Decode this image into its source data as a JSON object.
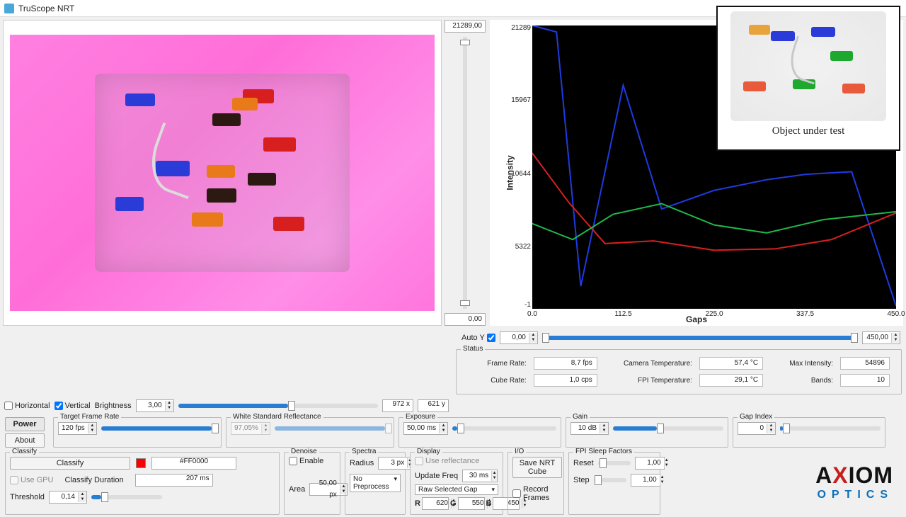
{
  "window": {
    "title": "TruScope NRT"
  },
  "vslider": {
    "top_value": "21289,00",
    "bottom_value": "0,00"
  },
  "chart_data": {
    "type": "line",
    "xlabel": "Gaps",
    "ylabel": "Intensity",
    "xlim": [
      0,
      450
    ],
    "ylim": [
      -1,
      21289
    ],
    "yticks": [
      "21289",
      "15967",
      "10644",
      "5322",
      "-1"
    ],
    "xticks": [
      "0.0",
      "112.5",
      "225.0",
      "337.5",
      "450.0"
    ],
    "series": [
      {
        "name": "blue",
        "color": "#1f3be0",
        "x": [
          0,
          30,
          60,
          112.5,
          160,
          225,
          290,
          337.5,
          395,
          450
        ],
        "y": [
          21289,
          20800,
          1700,
          16800,
          7500,
          8900,
          9700,
          10100,
          10300,
          200
        ]
      },
      {
        "name": "red",
        "color": "#d81f1f",
        "x": [
          0,
          45,
          90,
          150,
          225,
          300,
          370,
          450
        ],
        "y": [
          11700,
          8000,
          4900,
          5100,
          4400,
          4500,
          5200,
          7200
        ]
      },
      {
        "name": "green",
        "color": "#1fb84a",
        "x": [
          0,
          50,
          100,
          160,
          225,
          290,
          360,
          450
        ],
        "y": [
          6400,
          5200,
          7100,
          7900,
          6300,
          5700,
          6700,
          7300
        ]
      }
    ]
  },
  "auto_y": {
    "label": "Auto Y",
    "checked": true,
    "min": "0,00",
    "max": "450,00"
  },
  "status": {
    "legend": "Status",
    "frame_rate_label": "Frame Rate:",
    "frame_rate": "8,7 fps",
    "cube_rate_label": "Cube Rate:",
    "cube_rate": "1,0 cps",
    "cam_temp_label": "Camera Temperature:",
    "cam_temp": "57,4 °C",
    "fpi_temp_label": "FPI Temperature:",
    "fpi_temp": "29,1 °C",
    "max_int_label": "Max Intensity:",
    "max_int": "54896",
    "bands_label": "Bands:",
    "bands": "10"
  },
  "imgctrl": {
    "horizontal_label": "Horizontal",
    "horizontal_checked": false,
    "vertical_label": "Vertical",
    "vertical_checked": true,
    "brightness_label": "Brightness",
    "brightness_value": "3,00",
    "coord_x": "972 x",
    "coord_y": "621 y"
  },
  "tabs": {
    "power": "Power",
    "about": "About"
  },
  "target_fr": {
    "legend": "Target Frame Rate",
    "value": "120 fps"
  },
  "white_std": {
    "legend": "White Standard Reflectance",
    "value": "97,05%"
  },
  "exposure": {
    "legend": "Exposure",
    "value": "50,00 ms"
  },
  "gain": {
    "legend": "Gain",
    "value": "10 dB"
  },
  "gap_index": {
    "legend": "Gap Index",
    "value": "0"
  },
  "classify": {
    "legend": "Classify",
    "button": "Classify",
    "color_hex": "#FF0000",
    "gpu_label": "Use GPU",
    "gpu_checked": false,
    "dur_label": "Classify Duration",
    "dur_value": "207 ms",
    "threshold_label": "Threshold",
    "threshold": "0,14"
  },
  "denoise": {
    "legend": "Denoise",
    "enable_label": "Enable",
    "enable_checked": false,
    "area_label": "Area",
    "area_value": "50,00 px"
  },
  "spectra": {
    "legend": "Spectra",
    "radius_label": "Radius",
    "radius_value": "3 px",
    "preprocess": "No Preprocess"
  },
  "display": {
    "legend": "Display",
    "use_refl_label": "Use reflectance",
    "use_refl_checked": false,
    "update_label": "Update Freq",
    "update_value": "30 ms",
    "mode": "Raw Selected Gap",
    "r_label": "R",
    "r_val": "620",
    "g_label": "G",
    "g_val": "550",
    "b_label": "B",
    "b_val": "450"
  },
  "io": {
    "legend": "I/O",
    "save_btn": "Save NRT Cube",
    "record_label": "Record Frames",
    "record_checked": false
  },
  "sleep": {
    "legend": "FPI Sleep Factors",
    "reset_label": "Reset",
    "reset_value": "1,00",
    "step_label": "Step",
    "step_value": "1,00"
  },
  "inset": {
    "caption": "Object under test"
  },
  "logo": {
    "brand_a": "A",
    "brand_x": "X",
    "brand_rest": "IOM",
    "sub": "OPTICS"
  }
}
